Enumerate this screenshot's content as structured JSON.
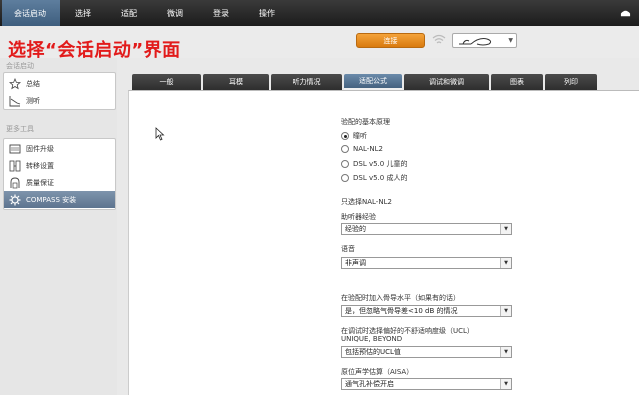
{
  "caption": "选择“会话启动”界面",
  "topnav": {
    "items": [
      {
        "label": "会话启动",
        "active": true
      },
      {
        "label": "选择"
      },
      {
        "label": "适配"
      },
      {
        "label": "微调"
      },
      {
        "label": "登录"
      },
      {
        "label": "操作"
      }
    ],
    "right_icon": "user-menu-icon"
  },
  "toolbar": {
    "connect_label": "连接",
    "wifi_icon": "wireless-icon",
    "device_icon": "hearing-aid-icon"
  },
  "sidebar": {
    "section1_label": "会话启动",
    "section1_items": [
      {
        "label": "总结",
        "icon": "star-icon"
      },
      {
        "label": "测听",
        "icon": "audiogram-icon"
      }
    ],
    "section2_label": "更多工具",
    "section2_items": [
      {
        "label": "固件升级",
        "icon": "firmware-icon"
      },
      {
        "label": "转移设置",
        "icon": "transfer-icon"
      },
      {
        "label": "质量保证",
        "icon": "quality-icon"
      },
      {
        "label": "COMPASS 安装",
        "icon": "gear-icon",
        "selected": true
      }
    ]
  },
  "tabs": [
    {
      "label": "一般"
    },
    {
      "label": "耳模"
    },
    {
      "label": "听力情况"
    },
    {
      "label": "适配公式",
      "active": true
    },
    {
      "label": "调试和微调"
    },
    {
      "label": "图表"
    },
    {
      "label": "列印"
    }
  ],
  "form": {
    "principle_label": "验配的基本原理",
    "principle_options": [
      {
        "label": "瞳听",
        "checked": true
      },
      {
        "label": "NAL-NL2"
      },
      {
        "label": "DSL v5.0 儿童的"
      },
      {
        "label": "DSL v5.0 成人的"
      }
    ],
    "only_select_label": "只选择NAL-NL2",
    "experience_label": "助听器经验",
    "experience_value": "经验的",
    "language_label": "语音",
    "language_value": "非声调",
    "bone_label": "在验配时加入骨导水平（如果有的话）",
    "bone_value": "是，但忽略气骨导差<10 dB 的情况",
    "ucl_label1": "在调试时选择偏好的不舒适响度级（UCL）",
    "ucl_label2": "UNIQUE, BEYOND",
    "ucl_value": "包括预估的UCL值",
    "aisa_label": "原位声学估算（AISA）",
    "aisa_value": "通气孔补偿开启"
  },
  "colors": {
    "accent": "#4f6f8f",
    "connect": "#e88c1f",
    "caption": "#e21b1b"
  }
}
